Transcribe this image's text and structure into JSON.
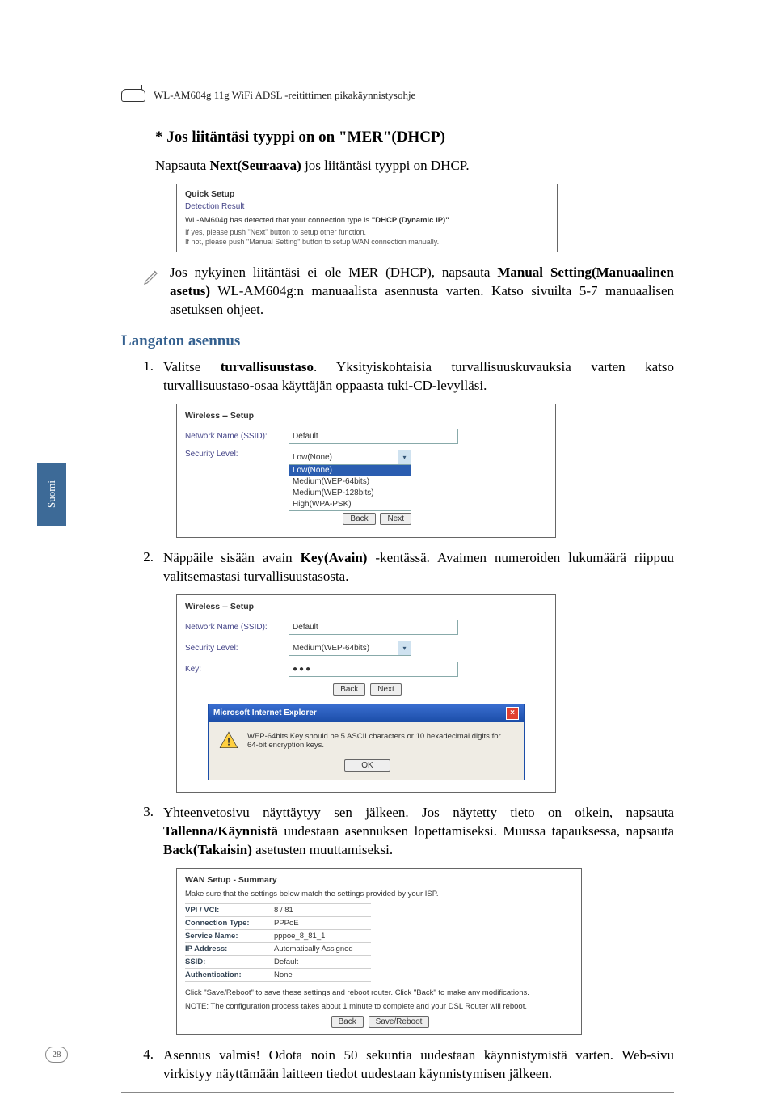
{
  "header": {
    "product_line": "WL-AM604g 11g WiFi ADSL -reitittimen pikakäynnistysohje"
  },
  "sidebar": {
    "lang_tab": "Suomi"
  },
  "page_number": "28",
  "section_mer": {
    "heading": "* Jos liitäntäsi tyyppi on on \"MER\"(DHCP)",
    "subtext_pre": "Napsauta ",
    "subtext_bold": "Next(Seuraava)",
    "subtext_post": " jos liitäntäsi tyyppi on DHCP.",
    "panel": {
      "title": "Quick Setup",
      "subtitle": "Detection Result",
      "line_pre": "WL-AM604g has detected that your connection type is ",
      "line_bold": "\"DHCP (Dynamic IP)\"",
      "line_post": ".",
      "note1": "If yes, please push \"Next\" button to setup other function.",
      "note2": "If not, please push \"Manual Setting\" button to setup WAN connection manually."
    },
    "note_pre": "Jos nykyinen liitäntäsi ei ole MER (DHCP), napsauta ",
    "note_bold": "Manual Setting(Manuaalinen asetus)",
    "note_post": " WL-AM604g:n manuaalista asennusta varten. Katso sivuilta 5-7 manuaalisen asetuksen ohjeet."
  },
  "section_wireless": {
    "heading": "Langaton asennus",
    "step1_pre": "Valitse ",
    "step1_bold": "turvallisuustaso",
    "step1_post": ". Yksityiskohtaisia turvallisuuskuvauksia varten katso turvallisuustaso-osaa käyttäjän oppaasta tuki-CD-levylläsi.",
    "panel1": {
      "title": "Wireless -- Setup",
      "ssid_label": "Network Name (SSID):",
      "ssid_value": "Default",
      "sec_label": "Security Level:",
      "sec_selected": "Low(None)",
      "options": [
        "Low(None)",
        "Medium(WEP-64bits)",
        "Medium(WEP-128bits)",
        "High(WPA-PSK)"
      ],
      "btn_back": "Back",
      "btn_next": "Next"
    },
    "step2_pre": "Näppäile sisään avain ",
    "step2_bold": "Key(Avain)",
    "step2_post": " -kentässä. Avaimen numeroiden lukumäärä riippuu valitsemastasi turvallisuustasosta.",
    "panel2": {
      "title": "Wireless -- Setup",
      "ssid_label": "Network Name (SSID):",
      "ssid_value": "Default",
      "sec_label": "Security Level:",
      "sec_value": "Medium(WEP-64bits)",
      "key_label": "Key:",
      "key_value": "●●●",
      "btn_back": "Back",
      "btn_next": "Next",
      "dialog_title": "Microsoft Internet Explorer",
      "dialog_msg": "WEP-64bits Key should be 5 ASCII characters or 10 hexadecimal digits for 64-bit encryption keys.",
      "dialog_ok": "OK"
    },
    "step3_pre": "Yhteenvetosivu näyttäytyy sen jälkeen. Jos näytetty tieto on oikein, napsauta ",
    "step3_bold1": "Tallenna/Käynnistä",
    "step3_mid": " uudestaan asennuksen lopettamiseksi. Muussa tapauksessa, napsauta ",
    "step3_bold2": "Back(Takaisin)",
    "step3_post": " asetusten muuttamiseksi.",
    "panel3": {
      "title": "WAN Setup - Summary",
      "line": "Make sure that the settings below match the settings provided by your ISP.",
      "rows": [
        {
          "label": "VPI / VCI:",
          "value": "8 / 81"
        },
        {
          "label": "Connection Type:",
          "value": "PPPoE"
        },
        {
          "label": "Service Name:",
          "value": "pppoe_8_81_1"
        },
        {
          "label": "IP Address:",
          "value": "Automatically Assigned"
        },
        {
          "label": "SSID:",
          "value": "Default"
        },
        {
          "label": "Authentication:",
          "value": "None"
        }
      ],
      "note1": "Click \"Save/Reboot\" to save these settings and reboot router. Click \"Back\" to make any modifications.",
      "note2": "NOTE: The configuration process takes about 1 minute to complete and your DSL Router will reboot.",
      "btn_back": "Back",
      "btn_save": "Save/Reboot"
    },
    "step4": "Asennus valmis! Odota noin 50 sekuntia uudestaan käynnistymistä varten. Web-sivu virkistyy näyttämään laitteen tiedot uudestaan käynnistymisen jälkeen."
  }
}
